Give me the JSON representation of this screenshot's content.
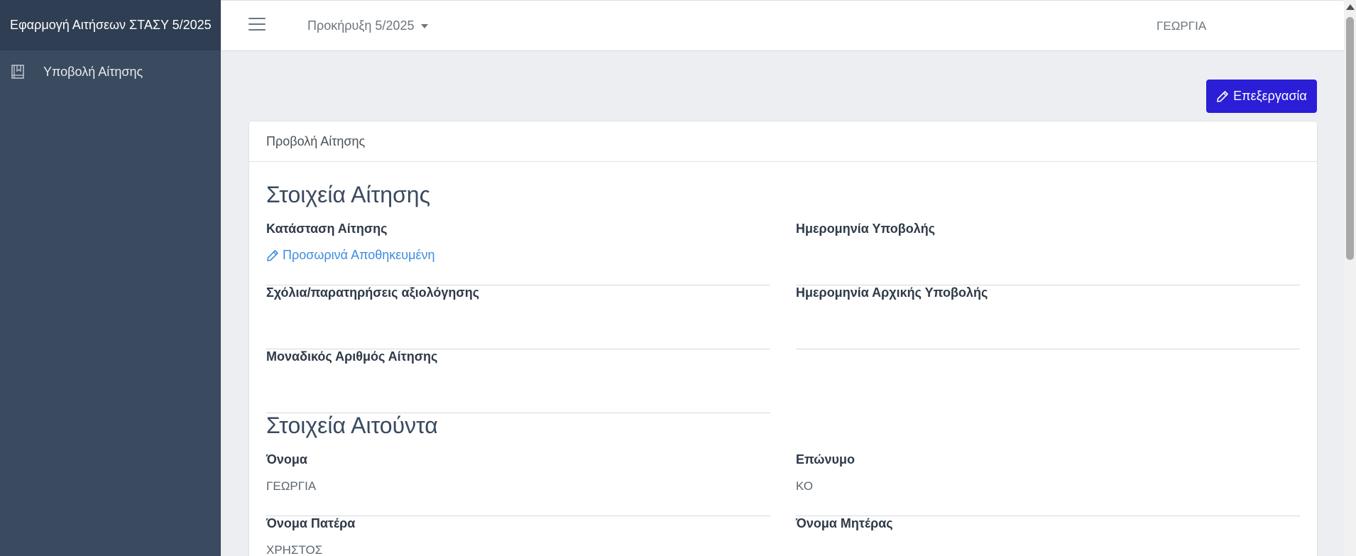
{
  "sidebar": {
    "brand": "Εφαρμογή Αιτήσεων ΣΤΑΣΥ 5/2025",
    "items": [
      {
        "label": "Υποβολή Αίτησης",
        "icon": "book-icon"
      }
    ]
  },
  "topbar": {
    "proclamation": "Προκήρυξη 5/2025",
    "user": "ΓΕΩΡΓΙΑ"
  },
  "toolbar": {
    "edit_label": "Επεξεργασία"
  },
  "card": {
    "header": "Προβολή Αίτησης",
    "application_section": {
      "title": "Στοιχεία Αίτησης",
      "status_label": "Κατάσταση Αίτησης",
      "status_value": "Προσωρινά Αποθηκευμένη",
      "submission_date_label": "Ημερομηνία Υποβολής",
      "submission_date_value": "",
      "comments_label": "Σχόλια/παρατηρήσεις αξιολόγησης",
      "comments_value": "",
      "initial_submission_label": "Ημερομηνία Αρχικής Υποβολής",
      "initial_submission_value": "",
      "unique_number_label": "Μοναδικός Αριθμός Αίτησης",
      "unique_number_value": ""
    },
    "applicant_section": {
      "title": "Στοιχεία Αιτούντα",
      "first_name_label": "Όνομα",
      "first_name_value": "ΓΕΩΡΓΙΑ",
      "last_name_label": "Επώνυμο",
      "last_name_value": "ΚΟ",
      "father_name_label": "Όνομα Πατέρα",
      "father_name_value": "ΧΡΗΣΤΟΣ",
      "mother_name_label": "Όνομα Μητέρας",
      "mother_name_value": ""
    }
  },
  "colors": {
    "sidebar": "#3a4a5f",
    "sidebar_brand": "#2f3e52",
    "primary_button": "#2b1ed6",
    "link": "#3d8be0",
    "background": "#eceef1"
  }
}
